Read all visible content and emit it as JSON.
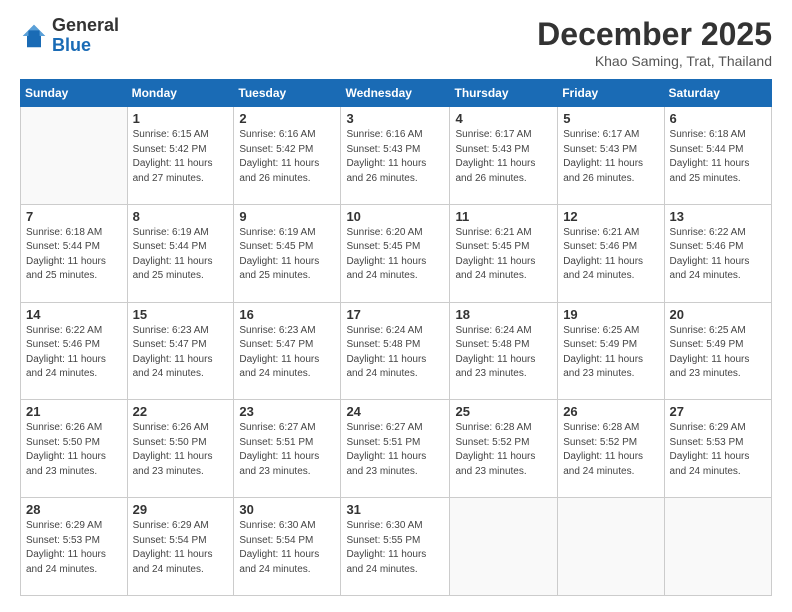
{
  "logo": {
    "general": "General",
    "blue": "Blue"
  },
  "title": "December 2025",
  "location": "Khao Saming, Trat, Thailand",
  "days_header": [
    "Sunday",
    "Monday",
    "Tuesday",
    "Wednesday",
    "Thursday",
    "Friday",
    "Saturday"
  ],
  "weeks": [
    [
      {
        "day": "",
        "detail": ""
      },
      {
        "day": "1",
        "detail": "Sunrise: 6:15 AM\nSunset: 5:42 PM\nDaylight: 11 hours\nand 27 minutes."
      },
      {
        "day": "2",
        "detail": "Sunrise: 6:16 AM\nSunset: 5:42 PM\nDaylight: 11 hours\nand 26 minutes."
      },
      {
        "day": "3",
        "detail": "Sunrise: 6:16 AM\nSunset: 5:43 PM\nDaylight: 11 hours\nand 26 minutes."
      },
      {
        "day": "4",
        "detail": "Sunrise: 6:17 AM\nSunset: 5:43 PM\nDaylight: 11 hours\nand 26 minutes."
      },
      {
        "day": "5",
        "detail": "Sunrise: 6:17 AM\nSunset: 5:43 PM\nDaylight: 11 hours\nand 26 minutes."
      },
      {
        "day": "6",
        "detail": "Sunrise: 6:18 AM\nSunset: 5:44 PM\nDaylight: 11 hours\nand 25 minutes."
      }
    ],
    [
      {
        "day": "7",
        "detail": "Sunrise: 6:18 AM\nSunset: 5:44 PM\nDaylight: 11 hours\nand 25 minutes."
      },
      {
        "day": "8",
        "detail": "Sunrise: 6:19 AM\nSunset: 5:44 PM\nDaylight: 11 hours\nand 25 minutes."
      },
      {
        "day": "9",
        "detail": "Sunrise: 6:19 AM\nSunset: 5:45 PM\nDaylight: 11 hours\nand 25 minutes."
      },
      {
        "day": "10",
        "detail": "Sunrise: 6:20 AM\nSunset: 5:45 PM\nDaylight: 11 hours\nand 24 minutes."
      },
      {
        "day": "11",
        "detail": "Sunrise: 6:21 AM\nSunset: 5:45 PM\nDaylight: 11 hours\nand 24 minutes."
      },
      {
        "day": "12",
        "detail": "Sunrise: 6:21 AM\nSunset: 5:46 PM\nDaylight: 11 hours\nand 24 minutes."
      },
      {
        "day": "13",
        "detail": "Sunrise: 6:22 AM\nSunset: 5:46 PM\nDaylight: 11 hours\nand 24 minutes."
      }
    ],
    [
      {
        "day": "14",
        "detail": "Sunrise: 6:22 AM\nSunset: 5:46 PM\nDaylight: 11 hours\nand 24 minutes."
      },
      {
        "day": "15",
        "detail": "Sunrise: 6:23 AM\nSunset: 5:47 PM\nDaylight: 11 hours\nand 24 minutes."
      },
      {
        "day": "16",
        "detail": "Sunrise: 6:23 AM\nSunset: 5:47 PM\nDaylight: 11 hours\nand 24 minutes."
      },
      {
        "day": "17",
        "detail": "Sunrise: 6:24 AM\nSunset: 5:48 PM\nDaylight: 11 hours\nand 24 minutes."
      },
      {
        "day": "18",
        "detail": "Sunrise: 6:24 AM\nSunset: 5:48 PM\nDaylight: 11 hours\nand 23 minutes."
      },
      {
        "day": "19",
        "detail": "Sunrise: 6:25 AM\nSunset: 5:49 PM\nDaylight: 11 hours\nand 23 minutes."
      },
      {
        "day": "20",
        "detail": "Sunrise: 6:25 AM\nSunset: 5:49 PM\nDaylight: 11 hours\nand 23 minutes."
      }
    ],
    [
      {
        "day": "21",
        "detail": "Sunrise: 6:26 AM\nSunset: 5:50 PM\nDaylight: 11 hours\nand 23 minutes."
      },
      {
        "day": "22",
        "detail": "Sunrise: 6:26 AM\nSunset: 5:50 PM\nDaylight: 11 hours\nand 23 minutes."
      },
      {
        "day": "23",
        "detail": "Sunrise: 6:27 AM\nSunset: 5:51 PM\nDaylight: 11 hours\nand 23 minutes."
      },
      {
        "day": "24",
        "detail": "Sunrise: 6:27 AM\nSunset: 5:51 PM\nDaylight: 11 hours\nand 23 minutes."
      },
      {
        "day": "25",
        "detail": "Sunrise: 6:28 AM\nSunset: 5:52 PM\nDaylight: 11 hours\nand 23 minutes."
      },
      {
        "day": "26",
        "detail": "Sunrise: 6:28 AM\nSunset: 5:52 PM\nDaylight: 11 hours\nand 24 minutes."
      },
      {
        "day": "27",
        "detail": "Sunrise: 6:29 AM\nSunset: 5:53 PM\nDaylight: 11 hours\nand 24 minutes."
      }
    ],
    [
      {
        "day": "28",
        "detail": "Sunrise: 6:29 AM\nSunset: 5:53 PM\nDaylight: 11 hours\nand 24 minutes."
      },
      {
        "day": "29",
        "detail": "Sunrise: 6:29 AM\nSunset: 5:54 PM\nDaylight: 11 hours\nand 24 minutes."
      },
      {
        "day": "30",
        "detail": "Sunrise: 6:30 AM\nSunset: 5:54 PM\nDaylight: 11 hours\nand 24 minutes."
      },
      {
        "day": "31",
        "detail": "Sunrise: 6:30 AM\nSunset: 5:55 PM\nDaylight: 11 hours\nand 24 minutes."
      },
      {
        "day": "",
        "detail": ""
      },
      {
        "day": "",
        "detail": ""
      },
      {
        "day": "",
        "detail": ""
      }
    ]
  ]
}
